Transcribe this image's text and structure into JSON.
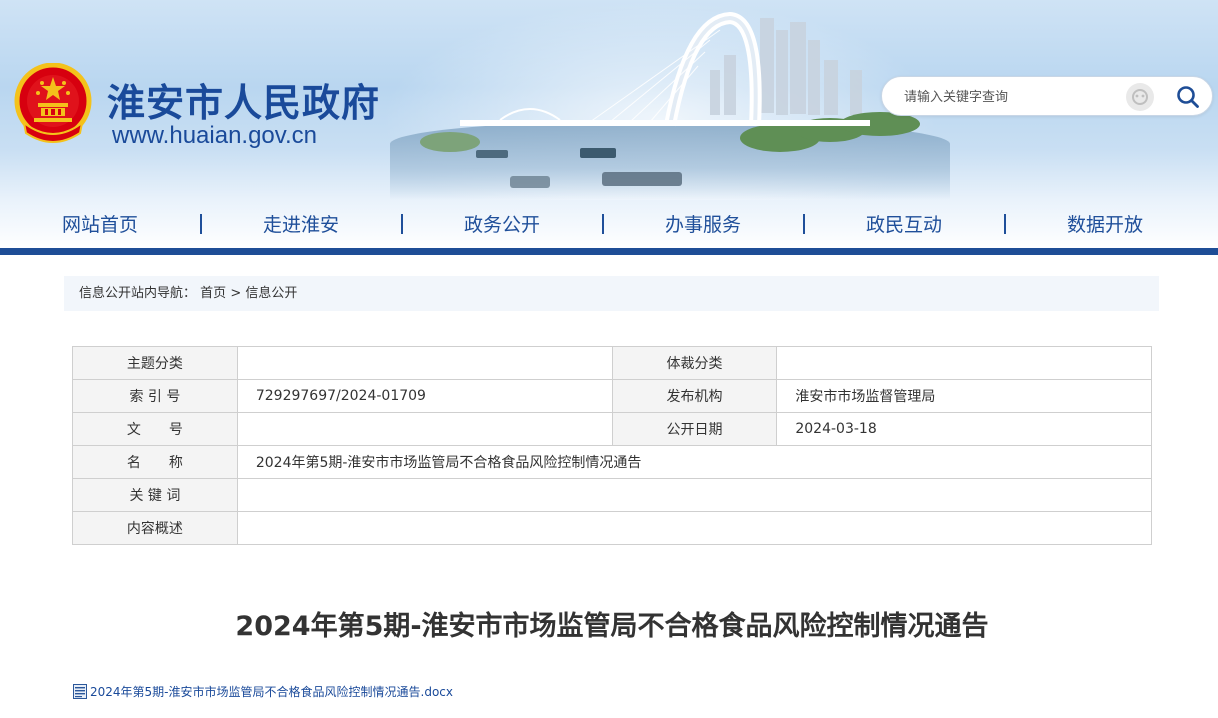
{
  "header": {
    "site_title": "淮安市人民政府",
    "site_url": "www.huaian.gov.cn",
    "search_placeholder": "请输入关键字查询"
  },
  "nav": {
    "items": [
      {
        "label": "网站首页"
      },
      {
        "label": "走进淮安"
      },
      {
        "label": "政务公开"
      },
      {
        "label": "办事服务"
      },
      {
        "label": "政民互动"
      },
      {
        "label": "数据开放"
      }
    ],
    "separator": "|"
  },
  "breadcrumb": {
    "prefix": "信息公开站内导航：",
    "home": "首页",
    "sep": ">",
    "current": "信息公开"
  },
  "info": {
    "topic_label": "主题分类",
    "topic_value": "",
    "genre_label": "体裁分类",
    "genre_value": "",
    "index_label": "索 引 号",
    "index_value": "729297697/2024-01709",
    "publisher_label": "发布机构",
    "publisher_value": "淮安市市场监督管理局",
    "docno_label": "文　　号",
    "docno_value": "",
    "date_label": "公开日期",
    "date_value": "2024-03-18",
    "name_label": "名　　称",
    "name_value": "2024年第5期-淮安市市场监管局不合格食品风险控制情况通告",
    "keywords_label": "关 键 词",
    "keywords_value": "",
    "summary_label": "内容概述",
    "summary_value": ""
  },
  "document": {
    "title": "2024年第5期-淮安市市场监管局不合格食品风险控制情况通告",
    "attachment": "2024年第5期-淮安市市场监管局不合格食品风险控制情况通告.docx"
  },
  "colors": {
    "brand_blue": "#1e4d96",
    "nav_text": "#1f4f9a",
    "emblem_red": "#d7000f",
    "emblem_gold": "#f4c21b"
  }
}
